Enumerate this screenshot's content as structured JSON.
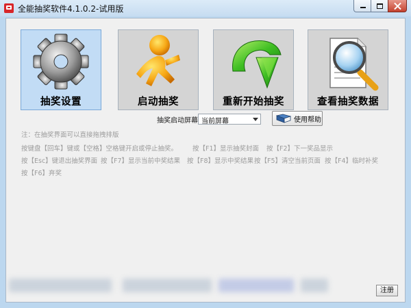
{
  "window": {
    "title": "全能抽奖软件4.1.0.2-试用版"
  },
  "tiles": [
    {
      "label": "抽奖设置",
      "icon": "gear-icon"
    },
    {
      "label": "启动抽奖",
      "icon": "running-man-icon"
    },
    {
      "label": "重新开始抽奖",
      "icon": "refresh-arrow-icon"
    },
    {
      "label": "查看抽奖数据",
      "icon": "document-search-icon"
    }
  ],
  "controls": {
    "screen_label": "抽奖启动屏幕",
    "screen_select_value": "当前屏幕",
    "help_label": "使用帮助",
    "help_icon": "book-icon"
  },
  "hints": {
    "note": "注：在抽奖界面可以直接拖拽排版",
    "line1a": "按键盘【回车】键或【空格】空格键开启或停止抽奖。",
    "line1b": "按【F1】显示抽奖封面",
    "line1c": "按【F2】下一奖品显示",
    "line2a": "按【Esc】键退出抽奖界面",
    "line2b": "按【F7】显示当前中奖结果",
    "line2c": "按【F8】显示中奖结果",
    "line2d": "按【F5】清空当前页面",
    "line2e": "按【F4】临时补奖",
    "line3a": "按【F6】弃奖"
  },
  "footer": {
    "register_label": "注册"
  },
  "colors": {
    "window_frame": "#bcd7ef",
    "client_bg": "#f0f0f0",
    "selected_tile_bg": "#c2dcf5",
    "tile_bg": "#d4d4d4",
    "hint_text": "#9c9c9c",
    "close_button": "#c4412e"
  }
}
